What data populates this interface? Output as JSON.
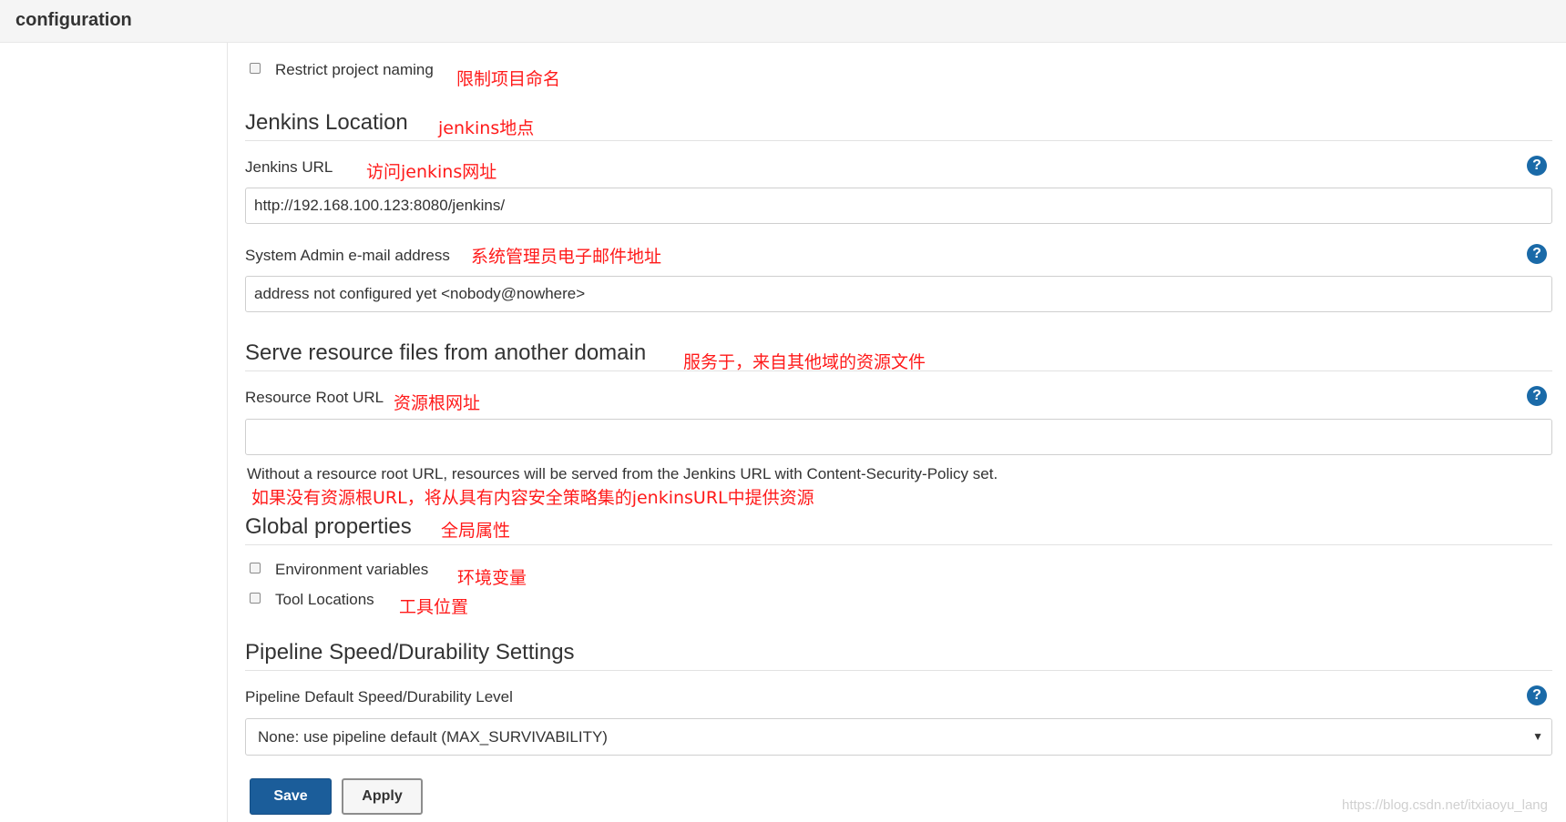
{
  "header": {
    "breadcrumb": "configuration"
  },
  "restrict": {
    "label": "Restrict project naming",
    "note": "限制项目命名",
    "checked": false
  },
  "jenkins_location": {
    "title": "Jenkins Location",
    "title_note": "jenkins地点",
    "url_label": "Jenkins URL",
    "url_note": "访问jenkins网址",
    "url_value": "http://192.168.100.123:8080/jenkins/",
    "email_label": "System Admin e-mail address",
    "email_note": "系统管理员电子邮件地址",
    "email_value": "address not configured yet <nobody@nowhere>"
  },
  "resource_domain": {
    "title": "Serve resource files from another domain",
    "title_note": "服务于，来自其他域的资源文件",
    "root_label": "Resource Root URL",
    "root_note": "资源根网址",
    "root_value": "",
    "description": "Without a resource root URL, resources will be served from the Jenkins URL with Content-Security-Policy set.",
    "description_note": "如果没有资源根URL，将从具有内容安全策略集的jenkinsURL中提供资源"
  },
  "global_properties": {
    "title": "Global properties",
    "title_note": "全局属性",
    "items": [
      {
        "label": "Environment variables",
        "note": "环境变量",
        "checked": false
      },
      {
        "label": "Tool Locations",
        "note": "工具位置",
        "checked": false
      }
    ]
  },
  "pipeline": {
    "title": "Pipeline Speed/Durability Settings",
    "level_label": "Pipeline Default Speed/Durability Level",
    "selected": "None: use pipeline default (MAX_SURVIVABILITY)"
  },
  "buttons": {
    "save": "Save",
    "apply": "Apply"
  },
  "help_glyph": "?",
  "select_arrow": "▼",
  "watermark": "https://blog.csdn.net/itxiaoyu_lang",
  "colors": {
    "annotation": "#ff1a1a",
    "primary": "#1b5d9a",
    "help": "#1a6aa8"
  }
}
